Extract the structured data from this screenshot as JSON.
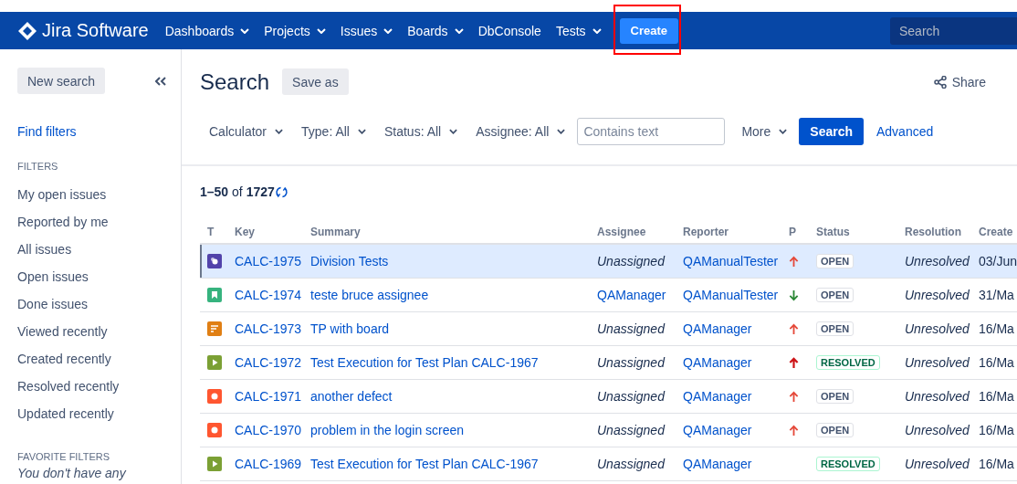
{
  "nav": {
    "logo": "Jira Software",
    "menus": [
      {
        "label": "Dashboards",
        "dropdown": true
      },
      {
        "label": "Projects",
        "dropdown": true
      },
      {
        "label": "Issues",
        "dropdown": true
      },
      {
        "label": "Boards",
        "dropdown": true
      },
      {
        "label": "DbConsole",
        "dropdown": false
      },
      {
        "label": "Tests",
        "dropdown": true
      }
    ],
    "create": "Create",
    "search": {
      "placeholder": "Search"
    }
  },
  "sidebar": {
    "new_search": "New search",
    "find_filters": "Find filters",
    "filters_heading": "FILTERS",
    "filters": [
      "My open issues",
      "Reported by me",
      "All issues",
      "Open issues",
      "Done issues",
      "Viewed recently",
      "Created recently",
      "Resolved recently",
      "Updated recently"
    ],
    "favorites_heading": "FAVORITE FILTERS",
    "favorites_note": "You don't have any"
  },
  "header": {
    "title": "Search",
    "save_as": "Save as",
    "share": "Share"
  },
  "filter_bar": {
    "dropdowns": [
      "Calculator",
      "Type: All",
      "Status: All",
      "Assignee: All"
    ],
    "text": {
      "placeholder": "Contains text"
    },
    "more": "More",
    "search": "Search",
    "advanced": "Advanced"
  },
  "results": {
    "count": "**1–50** of **1727**"
  },
  "table": {
    "columns": [
      "T",
      "Key",
      "Summary",
      "Assignee",
      "Reporter",
      "P",
      "Status",
      "Resolution",
      "Create"
    ],
    "rows": [
      {
        "selected": true,
        "type": {
          "kind": "test"
        },
        "key": "CALC-1975",
        "summary": "Division Tests",
        "assignee": "Unassigned",
        "assigned": false,
        "reporter": "QAManualTester",
        "priority": {
          "kind": "high"
        },
        "status": {
          "label": "OPEN",
          "kind": "open"
        },
        "resolution": "Unresolved",
        "created": "03/Jun"
      },
      {
        "selected": false,
        "type": {
          "kind": "story"
        },
        "key": "CALC-1974",
        "summary": "teste bruce assignee",
        "assignee": "QAManager",
        "assigned": true,
        "reporter": "QAManualTester",
        "priority": {
          "kind": "low"
        },
        "status": {
          "label": "OPEN",
          "kind": "open"
        },
        "resolution": "Unresolved",
        "created": "31/Ma"
      },
      {
        "selected": false,
        "type": {
          "kind": "test-plan"
        },
        "key": "CALC-1973",
        "summary": "TP with board",
        "assignee": "Unassigned",
        "assigned": false,
        "reporter": "QAManager",
        "priority": {
          "kind": "high"
        },
        "status": {
          "label": "OPEN",
          "kind": "open"
        },
        "resolution": "Unresolved",
        "created": "16/Ma"
      },
      {
        "selected": false,
        "type": {
          "kind": "test-execution"
        },
        "key": "CALC-1972",
        "summary": "Test Execution for Test Plan CALC-1967",
        "assignee": "Unassigned",
        "assigned": false,
        "reporter": "QAManager",
        "priority": {
          "kind": "highest"
        },
        "status": {
          "label": "RESOLVED",
          "kind": "resolved"
        },
        "resolution": "Unresolved",
        "created": "16/Ma"
      },
      {
        "selected": false,
        "type": {
          "kind": "bug"
        },
        "key": "CALC-1971",
        "summary": "another defect",
        "assignee": "Unassigned",
        "assigned": false,
        "reporter": "QAManager",
        "priority": {
          "kind": "high"
        },
        "status": {
          "label": "OPEN",
          "kind": "open"
        },
        "resolution": "Unresolved",
        "created": "16/Ma"
      },
      {
        "selected": false,
        "type": {
          "kind": "bug"
        },
        "key": "CALC-1970",
        "summary": "problem in the login screen",
        "assignee": "Unassigned",
        "assigned": false,
        "reporter": "QAManager",
        "priority": {
          "kind": "high"
        },
        "status": {
          "label": "OPEN",
          "kind": "open"
        },
        "resolution": "Unresolved",
        "created": "16/Ma"
      },
      {
        "selected": false,
        "type": {
          "kind": "test-execution"
        },
        "key": "CALC-1969",
        "summary": "Test Execution for Test Plan CALC-1967",
        "assignee": "Unassigned",
        "assigned": false,
        "reporter": "QAManager",
        "status": {
          "label": "RESOLVED",
          "kind": "resolved"
        },
        "resolution": "Unresolved",
        "created": "16/Ma"
      }
    ]
  }
}
